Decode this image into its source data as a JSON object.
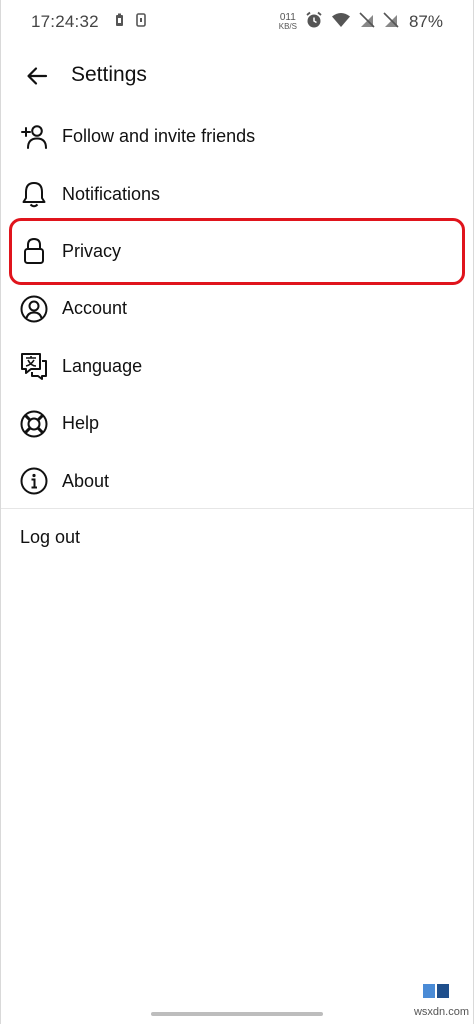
{
  "status_bar": {
    "time": "17:24:32",
    "net_speed_value": "011",
    "net_speed_unit": "KB/S",
    "battery": "87%"
  },
  "header": {
    "title": "Settings"
  },
  "menu": {
    "items": [
      {
        "label": "Follow and invite friends",
        "icon": "add-person-icon"
      },
      {
        "label": "Notifications",
        "icon": "bell-icon"
      },
      {
        "label": "Privacy",
        "icon": "lock-icon",
        "highlighted": true
      },
      {
        "label": "Account",
        "icon": "person-circle-icon"
      },
      {
        "label": "Language",
        "icon": "language-icon"
      },
      {
        "label": "Help",
        "icon": "lifebuoy-icon"
      },
      {
        "label": "About",
        "icon": "info-icon"
      }
    ]
  },
  "logout": {
    "label": "Log out"
  },
  "colors": {
    "highlight": "#e0141c",
    "text": "#111111",
    "divider": "#e6e6e6"
  },
  "watermark": {
    "text": "wsxdn.com"
  }
}
